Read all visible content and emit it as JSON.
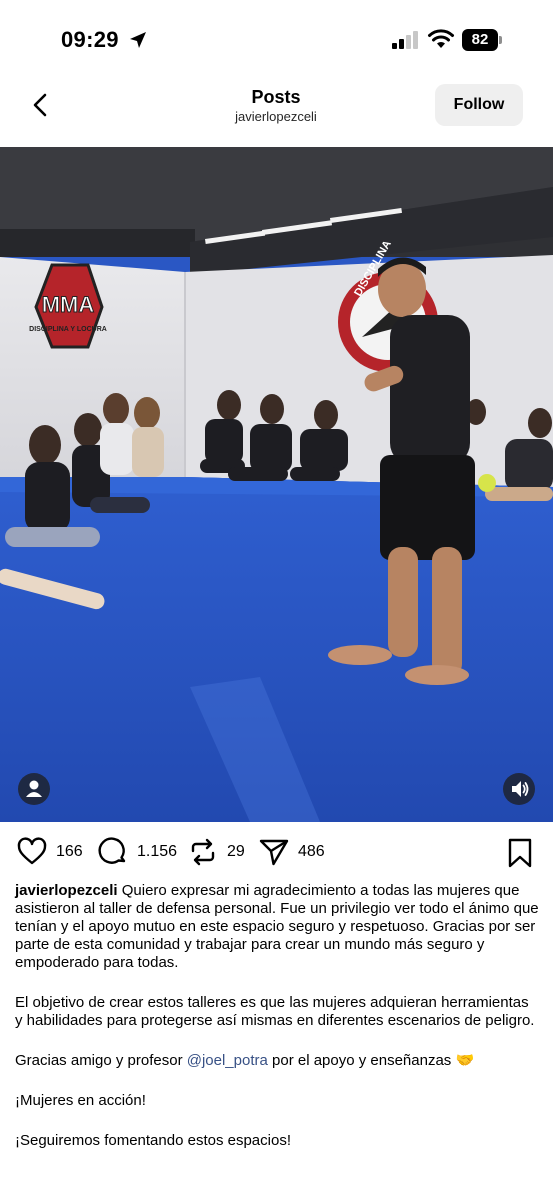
{
  "status_bar": {
    "time": "09:29",
    "battery": "82"
  },
  "header": {
    "title": "Posts",
    "username": "javierlopezceli",
    "follow_label": "Follow"
  },
  "photo": {
    "gym_logo_text": "MMA",
    "gym_logo_subtext": "DISCIPLINA Y LOCURA",
    "wall_logo_text": "DISCIPLINA"
  },
  "actions": {
    "likes": "166",
    "comments": "1.156",
    "reposts": "29",
    "shares": "486"
  },
  "caption": {
    "username": "javierlopezceli",
    "paragraph1": "Quiero expresar mi agradecimiento a todas las mujeres que asistieron al taller de defensa personal. Fue un privilegio ver todo el ánimo que tenían y el apoyo mutuo en este espacio seguro y respetuoso. Gracias por ser parte de esta comunidad y trabajar para crear un mundo más seguro y empoderado para todas.",
    "paragraph2": "El objetivo de crear estos talleres es que las mujeres adquieran herramientas y habilidades para protegerse así mismas en diferentes escenarios de peligro.",
    "paragraph3_prefix": "Gracias amigo y profesor ",
    "mention": "@joel_potra",
    "paragraph3_suffix": " por el apoyo y enseñanzas 🤝",
    "paragraph4": "¡Mujeres en acción!",
    "paragraph5": "¡Seguiremos fomentando estos espacios!"
  },
  "colors": {
    "mat_blue": "#2a57c4",
    "mention_blue": "#385185",
    "follow_bg": "#efefef"
  },
  "icons": [
    "location-arrow-icon",
    "signal-icon",
    "wifi-icon",
    "battery-icon",
    "back-chevron-icon",
    "heart-icon",
    "comment-icon",
    "repost-icon",
    "share-icon",
    "bookmark-icon",
    "person-tag-icon",
    "speaker-icon"
  ]
}
